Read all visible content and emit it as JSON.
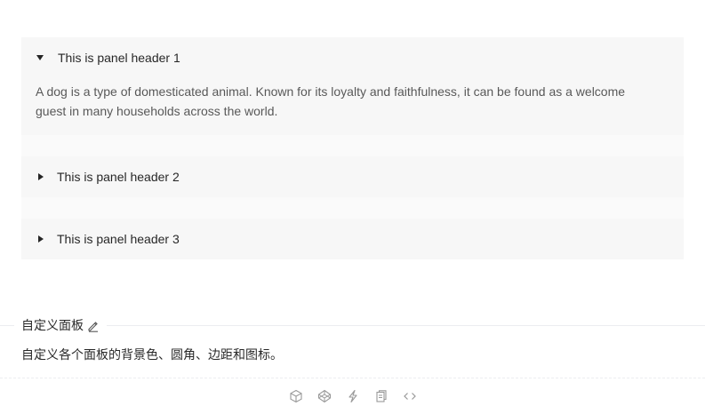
{
  "collapse": {
    "panels": [
      {
        "header": "This is panel header 1",
        "expanded": true,
        "content": "A dog is a type of domesticated animal. Known for its loyalty and faithfulness, it can be found as a welcome guest in many households across the world."
      },
      {
        "header": "This is panel header 2",
        "expanded": false
      },
      {
        "header": "This is panel header 3",
        "expanded": false
      }
    ],
    "panel_background": "#f7f7f7"
  },
  "meta": {
    "title": "自定义面板",
    "description": "自定义各个面板的背景色、圆角、边距和图标。",
    "actions": [
      {
        "icon": "codesandbox-icon"
      },
      {
        "icon": "codepen-icon"
      },
      {
        "icon": "thunderbolt-icon"
      },
      {
        "icon": "copy-icon"
      },
      {
        "icon": "code-icon"
      }
    ]
  }
}
